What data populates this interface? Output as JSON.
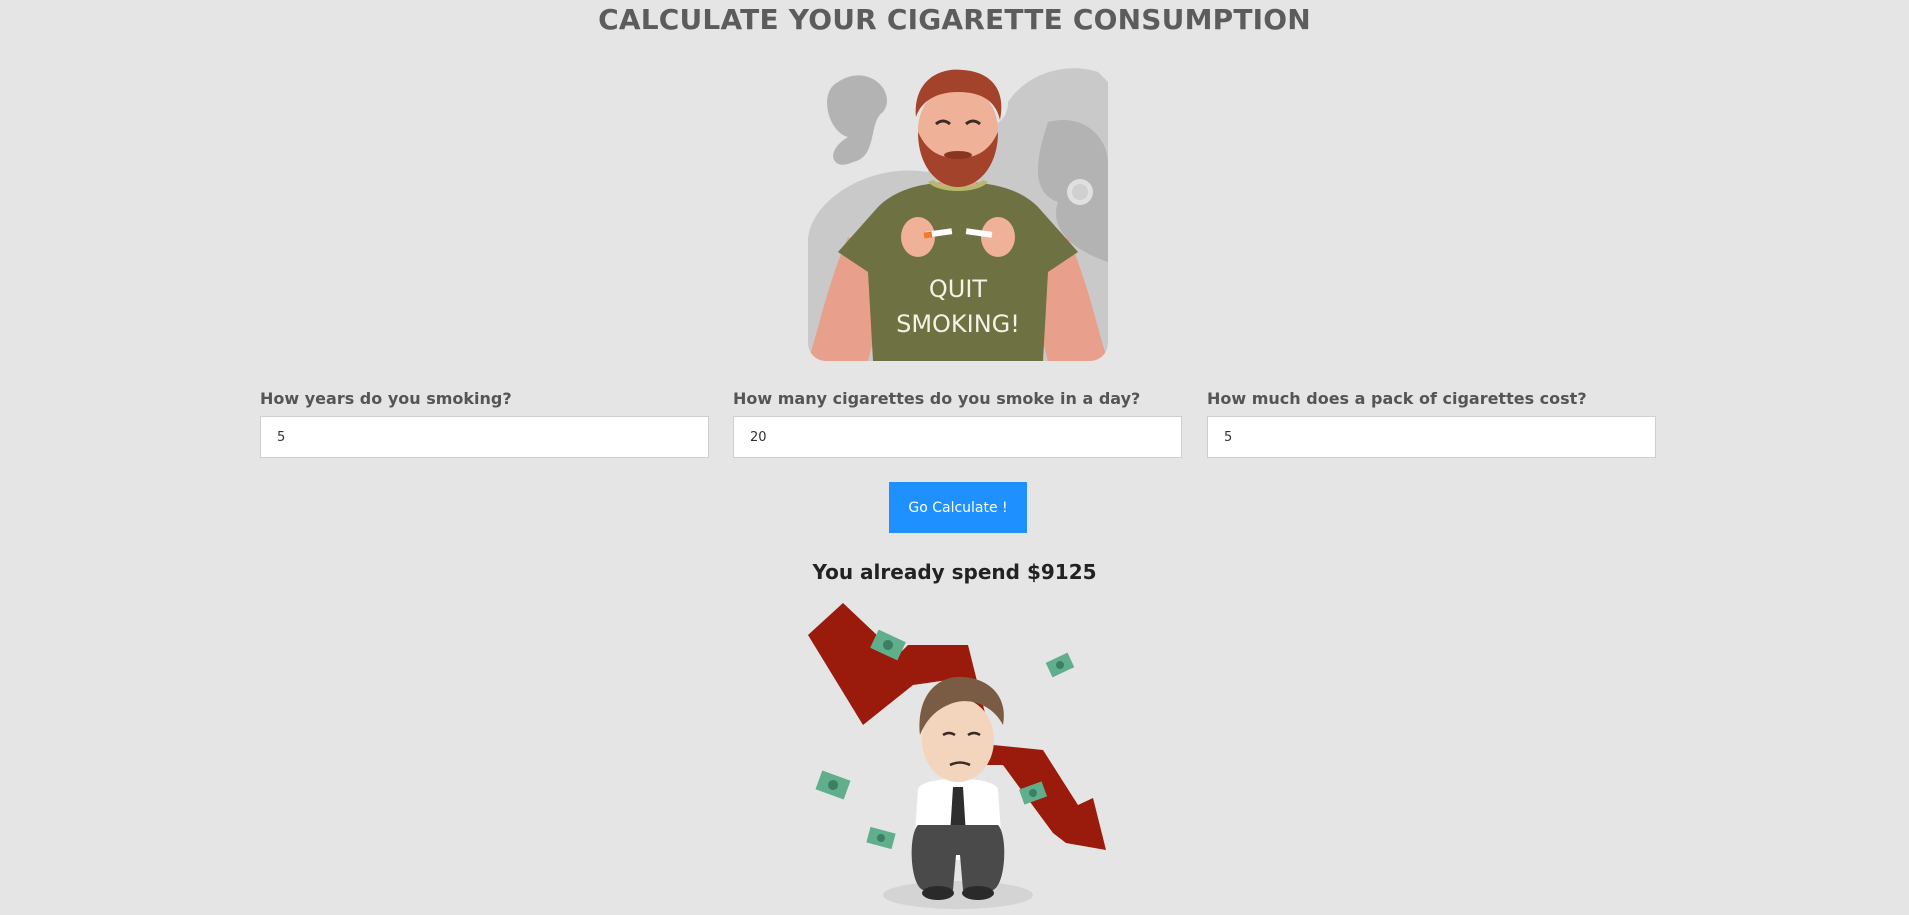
{
  "page": {
    "title": "CALCULATE YOUR CIGARETTE CONSUMPTION",
    "background": "#e5e5e5"
  },
  "hero_image": {
    "shirt_text_line1": "QUIT",
    "shirt_text_line2": "SMOKING!"
  },
  "form": {
    "years": {
      "label": "How years do you smoking?",
      "value": "5"
    },
    "per_day": {
      "label": "How many cigarettes do you smoke in a day?",
      "value": "20"
    },
    "pack_cost": {
      "label": "How much does a pack of cigarettes cost?",
      "value": "5"
    },
    "submit_label": "Go Calculate !",
    "accent_color": "#1e90ff"
  },
  "result": {
    "text": "You already spend $9125"
  }
}
